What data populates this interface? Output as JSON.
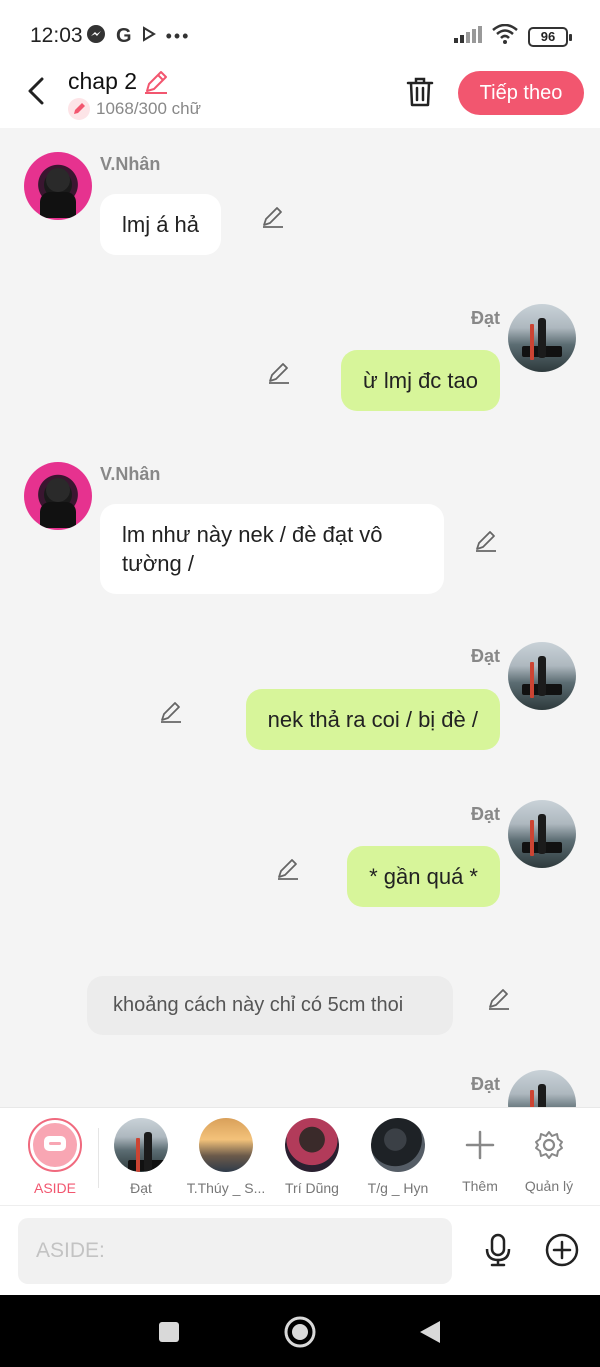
{
  "status_bar": {
    "time": "12:03",
    "battery": "96"
  },
  "header": {
    "title": "chap 2",
    "word_count": "1068/300 chữ",
    "next_label": "Tiếp theo"
  },
  "messages": [
    {
      "speaker": "V.Nhân",
      "text": "lmj á hả"
    },
    {
      "speaker": "Đạt",
      "text": "ừ lmj đc tao"
    },
    {
      "speaker": "V.Nhân",
      "text": "lm như này nek / đè đạt vô tường /"
    },
    {
      "speaker": "Đạt",
      "text": "nek thả ra coi / bị đè /"
    },
    {
      "speaker": "Đạt",
      "text": "* gần quá *"
    },
    {
      "speaker": "",
      "text": "khoảng cách này chỉ có 5cm thoi"
    },
    {
      "speaker": "Đạt",
      "text": ""
    }
  ],
  "characters": [
    {
      "label": "ASIDE"
    },
    {
      "label": "Đạt"
    },
    {
      "label": "T.Thúy _ S..."
    },
    {
      "label": "Trí Dũng"
    },
    {
      "label": "T/g _ Hyn"
    },
    {
      "label": "Thêm"
    },
    {
      "label": "Quản lý"
    }
  ],
  "input": {
    "placeholder": "ASIDE:"
  },
  "colors": {
    "accent": "#f2566f",
    "right_bubble": "#d7f59a",
    "background": "#f4f4f4"
  }
}
